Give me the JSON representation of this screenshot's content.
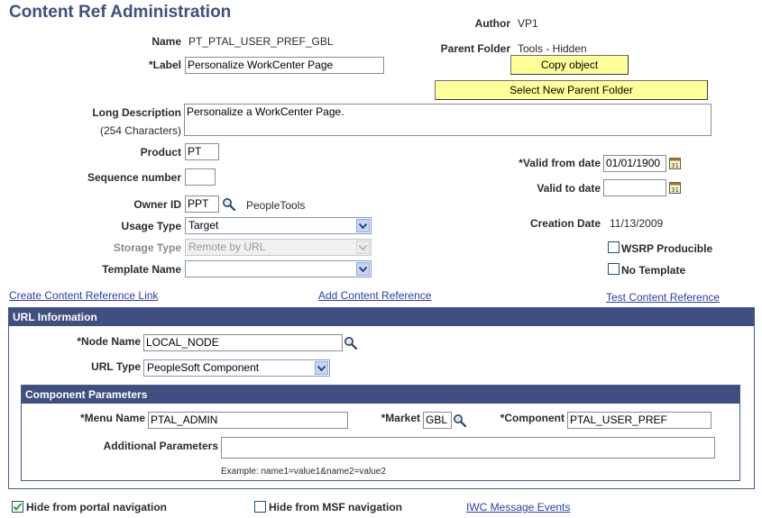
{
  "page": {
    "title": "Content Ref Administration"
  },
  "header": {
    "author_label": "Author",
    "author_value": "VP1",
    "parent_folder_label": "Parent Folder",
    "parent_folder_value": "Tools - Hidden",
    "copy_object_button": "Copy object",
    "select_parent_button": "Select New Parent Folder"
  },
  "form": {
    "name_label": "Name",
    "name_value": "PT_PTAL_USER_PREF_GBL",
    "label_label": "*Label",
    "label_value": "Personalize WorkCenter Page",
    "long_desc_label": "Long Description",
    "long_desc_sub": "(254 Characters)",
    "long_desc_value": "Personalize a WorkCenter Page.",
    "product_label": "Product",
    "product_value": "PT",
    "sequence_label": "Sequence number",
    "sequence_value": "",
    "owner_label": "Owner ID",
    "owner_value": "PPT",
    "owner_desc": "PeopleTools",
    "usage_label": "Usage Type",
    "usage_value": "Target",
    "storage_label": "Storage Type",
    "storage_value": "Remote by URL",
    "template_label": "Template Name",
    "template_value": "",
    "valid_from_label": "*Valid from date",
    "valid_from_value": "01/01/1900",
    "valid_to_label": "Valid to date",
    "valid_to_value": "",
    "creation_label": "Creation Date",
    "creation_value": "11/13/2009",
    "wsrp_label": "WSRP Producible",
    "no_template_label": "No Template"
  },
  "links": {
    "create_link": "Create Content Reference Link",
    "add_ref": "Add Content Reference",
    "test_ref": "Test Content Reference"
  },
  "url_info": {
    "header": "URL Information",
    "node_label": "*Node Name",
    "node_value": "LOCAL_NODE",
    "url_type_label": "URL Type",
    "url_type_value": "PeopleSoft Component",
    "component_params": {
      "header": "Component Parameters",
      "menu_label": "*Menu Name",
      "menu_value": "PTAL_ADMIN",
      "market_label": "*Market",
      "market_value": "GBL",
      "component_label": "*Component",
      "component_value": "PTAL_USER_PREF",
      "additional_label": "Additional Parameters",
      "additional_value": "",
      "example": "Example: name1=value1&name2=value2"
    }
  },
  "footer": {
    "hide_portal_label": "Hide from portal navigation",
    "hide_portal_checked": true,
    "hide_msf_label": "Hide from MSF navigation",
    "hide_msf_checked": false,
    "iwc_link": "IWC Message Events"
  },
  "colors": {
    "title": "#3f4f7f",
    "panel_header": "#3f4f7f",
    "button": "#ffff99",
    "link": "#2c3ea6"
  }
}
